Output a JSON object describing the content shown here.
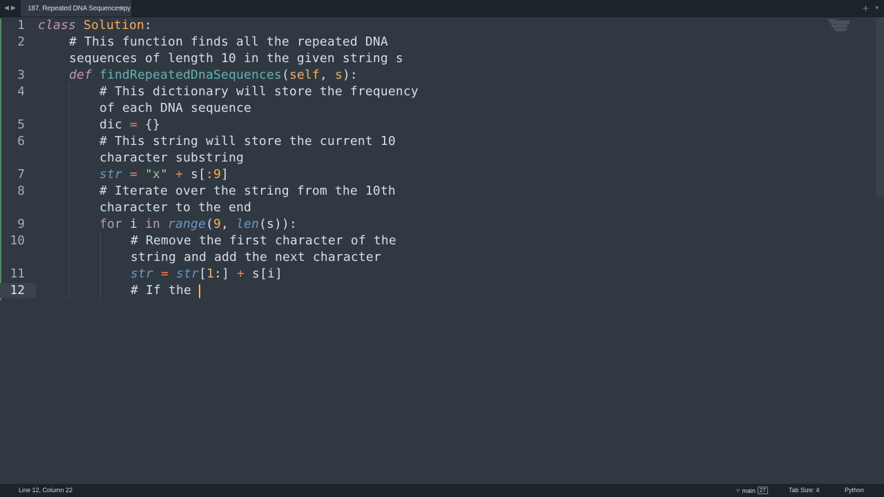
{
  "tab": {
    "title": "187. Repeated DNA Sequences.py"
  },
  "nav": {
    "back_icon": "◀",
    "forward_icon": "▶"
  },
  "tab_actions": {
    "new_tab_icon": "+",
    "menu_icon": "▾"
  },
  "editor": {
    "line_numbers": [
      "1",
      "2",
      "3",
      "4",
      "5",
      "6",
      "7",
      "8",
      "9",
      "10",
      "11",
      "12"
    ],
    "active_line": "12",
    "lines": {
      "l1": {
        "kw": "class",
        "name": "Solution",
        "colon": ":"
      },
      "l2a": "# This function finds all the repeated DNA",
      "l2b": "sequences of length 10 in the given string s",
      "l3": {
        "kw": "def",
        "name": "findRepeatedDnaSequences",
        "open": "(",
        "self": "self",
        "sep": ", ",
        "param": "s",
        "close": "):"
      },
      "l4a": "# This dictionary will store the frequency",
      "l4b": "of each DNA sequence",
      "l5": {
        "var": "dic",
        "op": "=",
        "val": "{}"
      },
      "l6a": "# This string will store the current 10",
      "l6b": "character substring",
      "l7": {
        "var": "str",
        "op": "=",
        "str": "\"x\"",
        "plus": "+",
        "s": "s[",
        "slice": ":9",
        "end": "]"
      },
      "l8a": "# Iterate over the string from the 10th",
      "l8b": "character to the end",
      "l9": {
        "for": "for",
        "i": "i",
        "in": "in",
        "range": "range",
        "open": "(",
        "nine": "9",
        "comma": ", ",
        "len": "len",
        "args": "(s)):"
      },
      "l10a": "# Remove the first character of the",
      "l10b": "string and add the next character",
      "l11": {
        "var": "str",
        "op": "=",
        "str2": "str",
        "open": "[",
        "one": "1",
        "colon": ":]",
        "plus": "+",
        "si": "s[i]"
      },
      "l12": "# If the "
    }
  },
  "status": {
    "position": "Line 12, Column 22",
    "branch": "main",
    "branch_icon": "⑂",
    "branch_count": "27",
    "tab_size": "Tab Size: 4",
    "syntax": "Python"
  }
}
